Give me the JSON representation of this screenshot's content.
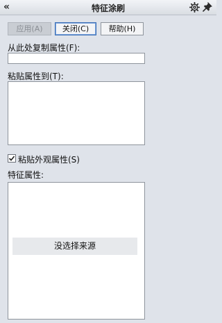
{
  "window": {
    "title": "特征涂刷",
    "icons": {
      "collapse": "double-chevron-left-icon",
      "settings": "gear-icon",
      "pin": "pin-icon"
    }
  },
  "buttons": {
    "apply": "应用(A)",
    "close": "关闭(C)",
    "help": "帮助(H)"
  },
  "copy_from": {
    "label": "从此处复制属性(F):",
    "value": ""
  },
  "paste_to": {
    "label": "粘贴属性到(T):"
  },
  "paste_appearance": {
    "label": "粘贴外观属性(S)",
    "checked": true
  },
  "feature_properties": {
    "label": "特征属性:",
    "empty_message": "没选择来源"
  }
}
